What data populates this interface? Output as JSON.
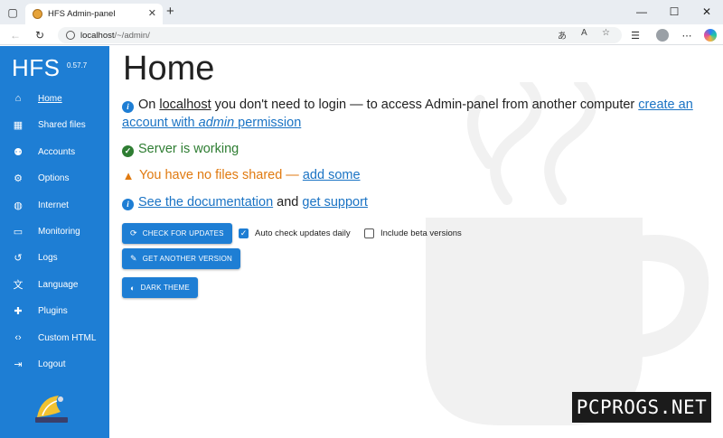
{
  "browser": {
    "tab_title": "HFS Admin-panel",
    "tab_close": "✕",
    "new_tab": "+",
    "url_host": "localhost",
    "url_path": "/~/admin/",
    "window_controls": {
      "minimize": "—",
      "maximize": "☐",
      "close": "✕"
    }
  },
  "sidebar": {
    "brand": "HFS",
    "version": "0.57.7",
    "items": [
      {
        "label": "Home",
        "icon": "home-icon",
        "glyph": "⌂",
        "active": true
      },
      {
        "label": "Shared files",
        "icon": "shared-files-icon",
        "glyph": "▦",
        "active": false
      },
      {
        "label": "Accounts",
        "icon": "accounts-icon",
        "glyph": "⚉",
        "active": false
      },
      {
        "label": "Options",
        "icon": "gear-icon",
        "glyph": "⚙",
        "active": false
      },
      {
        "label": "Internet",
        "icon": "globe-icon",
        "glyph": "◍",
        "active": false
      },
      {
        "label": "Monitoring",
        "icon": "monitor-icon",
        "glyph": "▭",
        "active": false
      },
      {
        "label": "Logs",
        "icon": "history-icon",
        "glyph": "↺",
        "active": false
      },
      {
        "label": "Language",
        "icon": "translate-icon",
        "glyph": "文",
        "active": false
      },
      {
        "label": "Plugins",
        "icon": "puzzle-icon",
        "glyph": "✚",
        "active": false
      },
      {
        "label": "Custom HTML",
        "icon": "code-icon",
        "glyph": "‹›",
        "active": false
      },
      {
        "label": "Logout",
        "icon": "logout-icon",
        "glyph": "⇥",
        "active": false
      }
    ]
  },
  "main": {
    "title": "Home",
    "login_note": {
      "prefix": "On",
      "host": "localhost",
      "middle": "you don't need to login — to access Admin-panel from another computer",
      "link1": "create an account with",
      "link_em": "admin",
      "link2": "permission"
    },
    "server_status": "Server is working",
    "no_files": {
      "text": "You have no files shared —",
      "link": "add some"
    },
    "docs": {
      "link1": "See the documentation",
      "and": "and",
      "link2": "get support"
    },
    "buttons": {
      "check_updates": "CHECK FOR UPDATES",
      "another_version": "GET ANOTHER VERSION",
      "dark_theme": "DARK THEME"
    },
    "checkboxes": {
      "auto_check": {
        "label": "Auto check updates daily",
        "checked": true
      },
      "beta": {
        "label": "Include beta versions",
        "checked": false
      }
    }
  },
  "watermark": "PCPROGS.NET",
  "colors": {
    "accent": "#1e7ed4",
    "success": "#2e7d32",
    "warning": "#e07a10",
    "link": "#1a73c4"
  }
}
